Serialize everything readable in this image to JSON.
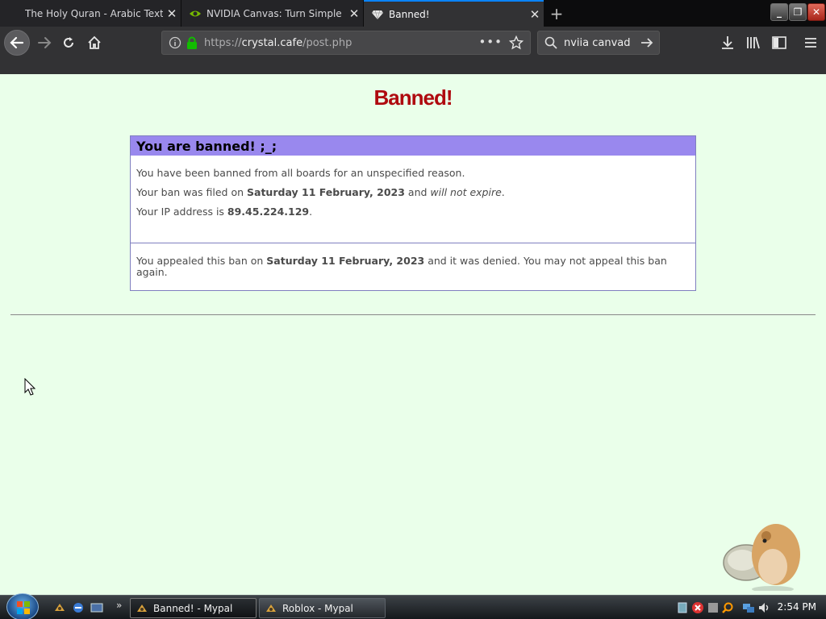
{
  "browser": {
    "tabs": [
      {
        "title": "The Holy Quran - Arabic Text and E",
        "active": false,
        "favicon": "page-icon"
      },
      {
        "title": "NVIDIA Canvas: Turn Simple Br",
        "active": false,
        "favicon": "nvidia-icon"
      },
      {
        "title": "Banned!",
        "active": true,
        "favicon": "crystal-icon"
      }
    ],
    "url_prefix": "https://",
    "url_domain": "crystal.cafe",
    "url_path": "/post.php",
    "search_value": "nviia canvad"
  },
  "page": {
    "title": "Banned!",
    "box_heading": "You are banned! ;_;",
    "reason_text": "You have been banned from all boards for an unspecified reason.",
    "filed_prefix": "Your ban was filed on ",
    "filed_date": "Saturday 11 February, 2023",
    "filed_mid": " and ",
    "filed_expire": "will not expire",
    "filed_end": ".",
    "ip_prefix": "Your IP address is ",
    "ip_address": "89.45.224.129",
    "ip_end": ".",
    "appeal_prefix": "You appealed this ban on ",
    "appeal_date": "Saturday 11 February, 2023",
    "appeal_suffix": " and it was denied. You may not appeal this ban again."
  },
  "taskbar": {
    "tasks": [
      {
        "label": "Banned! - Mypal",
        "active": true
      },
      {
        "label": "Roblox - Mypal",
        "active": false
      }
    ],
    "clock": "2:54 PM"
  },
  "colors": {
    "page_bg": "#eaffea",
    "title_red": "#af0a0f",
    "box_header": "#9988ee",
    "box_border": "#7f7fbf"
  }
}
